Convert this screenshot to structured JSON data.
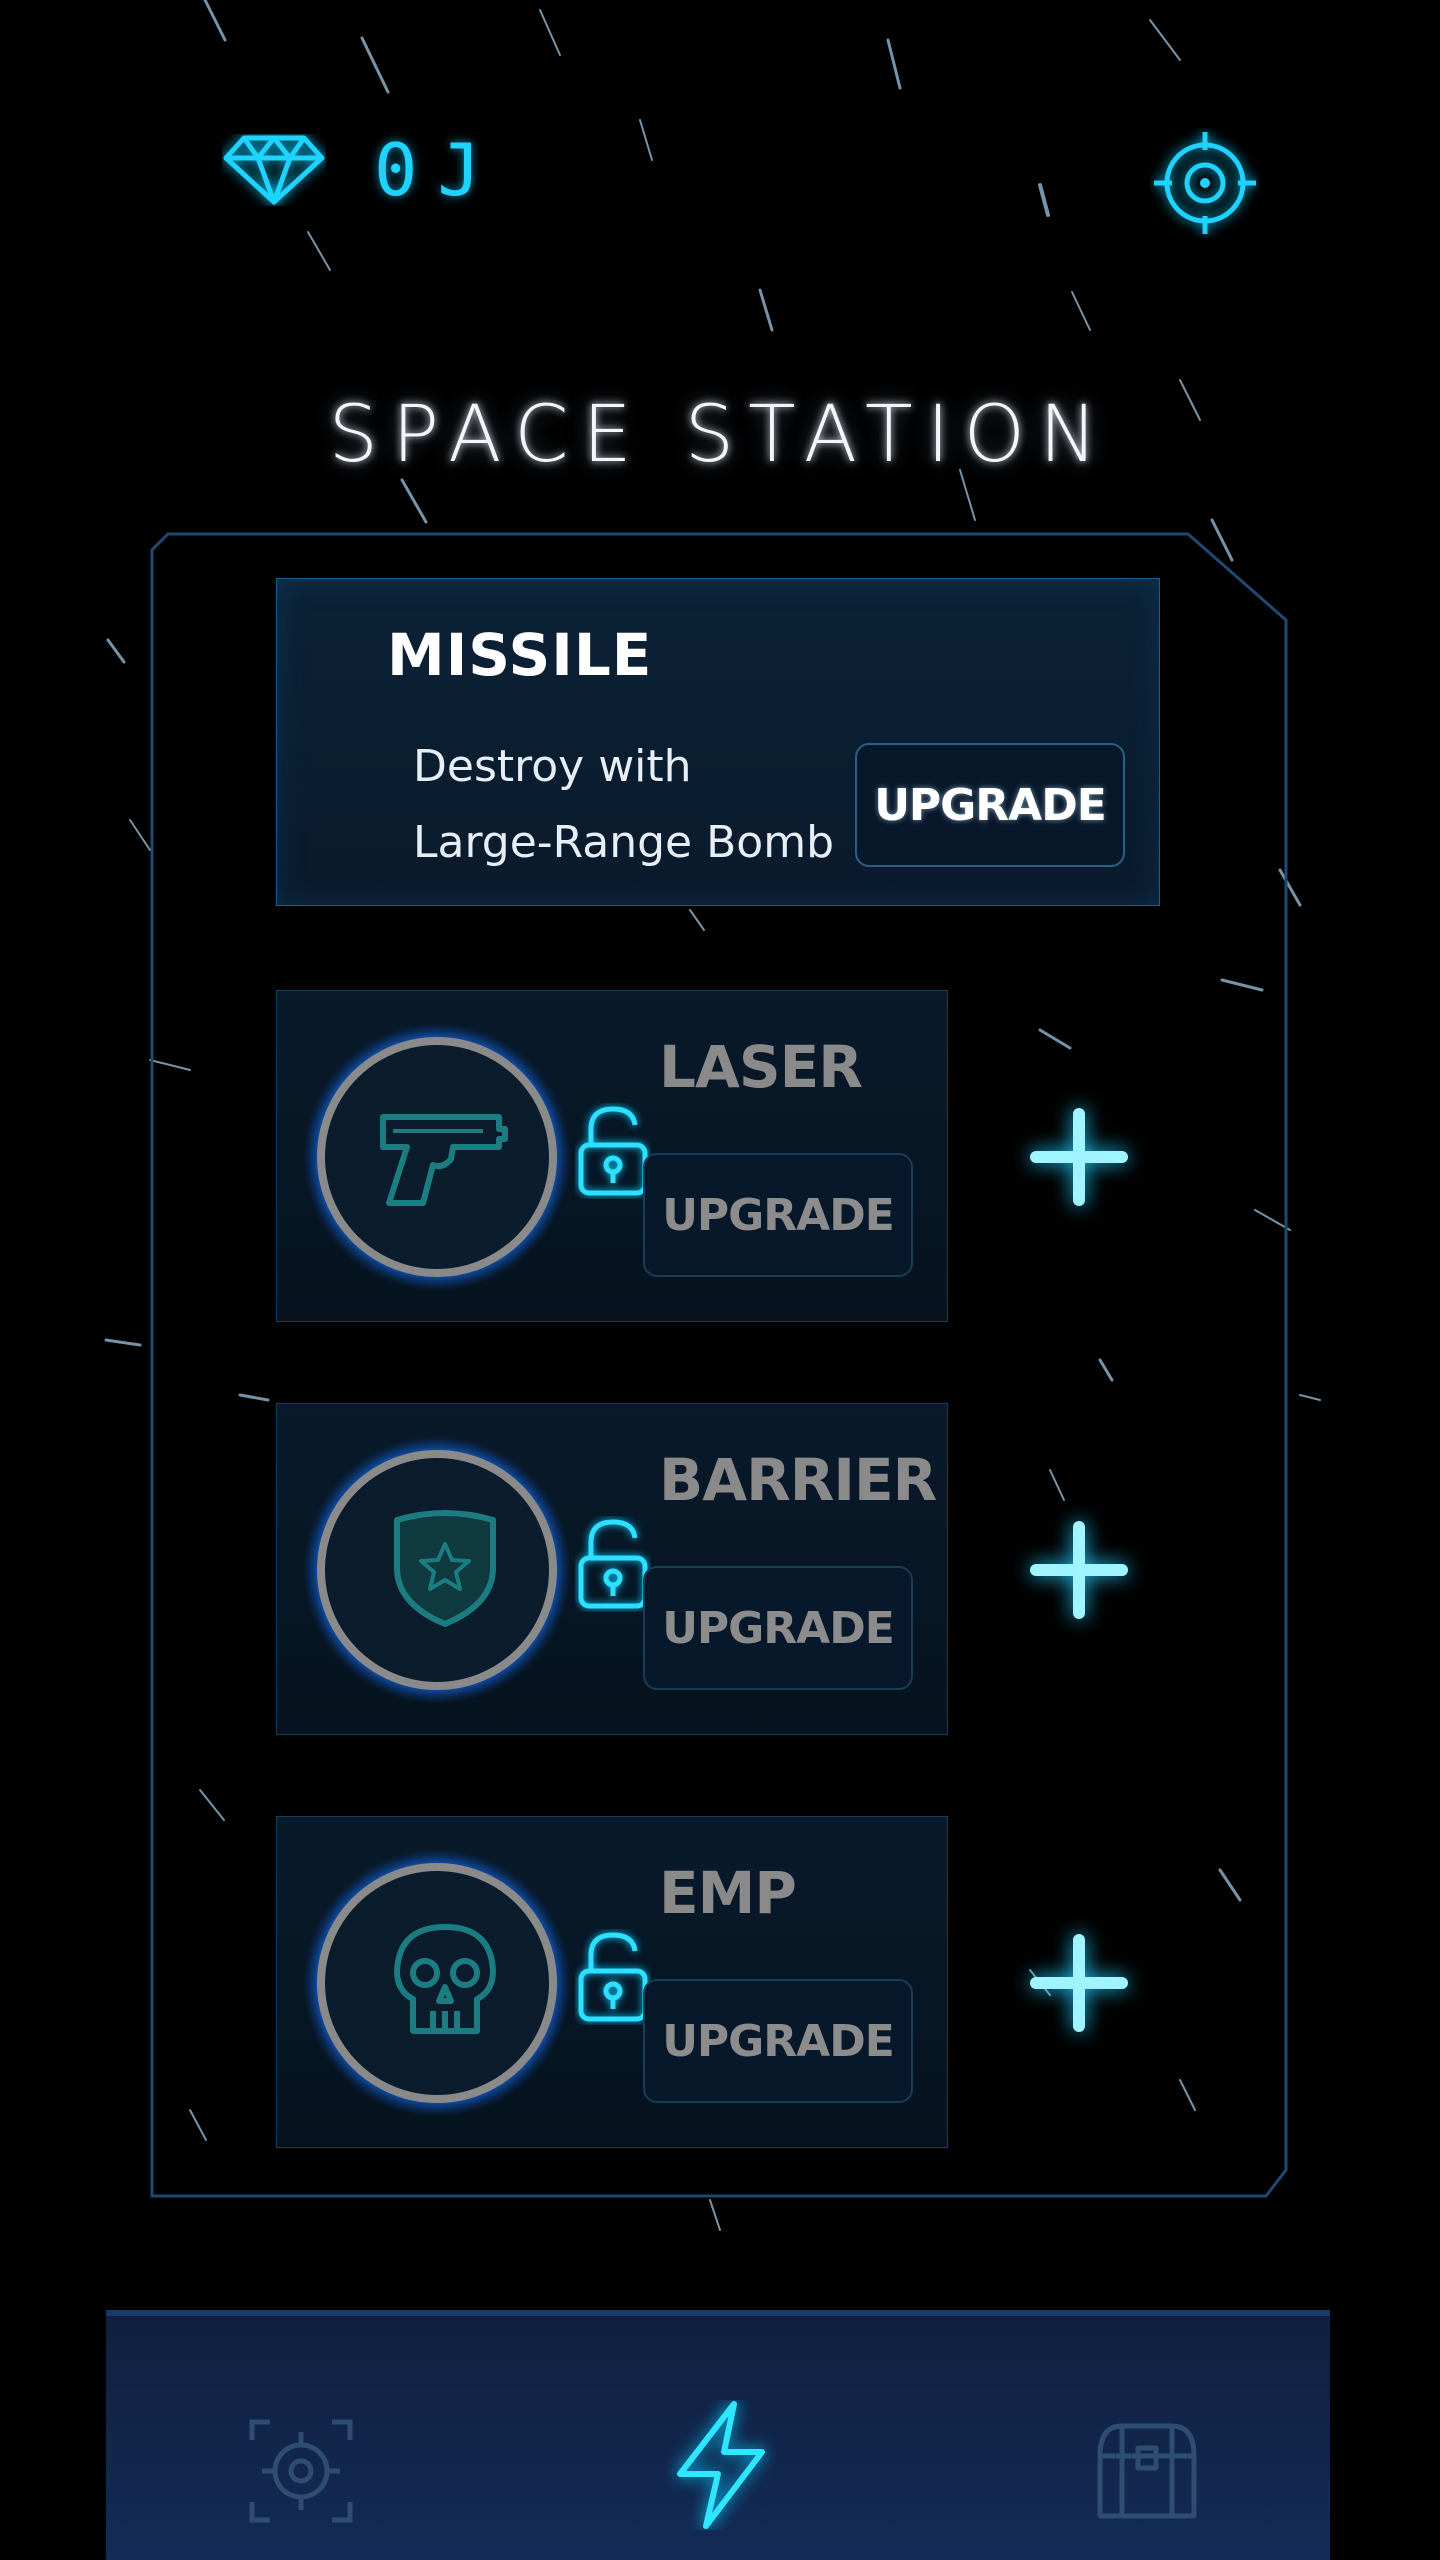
{
  "header": {
    "currency_icon": "diamond-icon",
    "currency_value": "0J",
    "settings_icon": "settings-target-icon"
  },
  "title": "SPACE STATION",
  "missile": {
    "name": "MISSILE",
    "description_line1": "Destroy with",
    "description_line2": "Large-Range Bomb",
    "upgrade_label": "UPGRADE"
  },
  "weapons": [
    {
      "name": "LASER",
      "icon": "pistol-icon",
      "locked": true,
      "upgrade_label": "UPGRADE"
    },
    {
      "name": "BARRIER",
      "icon": "shield-star-icon",
      "locked": true,
      "upgrade_label": "UPGRADE"
    },
    {
      "name": "EMP",
      "icon": "skull-icon",
      "locked": true,
      "upgrade_label": "UPGRADE"
    }
  ],
  "bottom_nav": [
    {
      "icon": "crosshair-icon",
      "active": false
    },
    {
      "icon": "lightning-icon",
      "active": true
    },
    {
      "icon": "treasure-chest-icon",
      "active": false
    }
  ],
  "colors": {
    "accent": "#1fd3ff",
    "panel": "#0b2236",
    "inactive_text": "#8a8a8a",
    "nav_bg": "#132b57"
  }
}
